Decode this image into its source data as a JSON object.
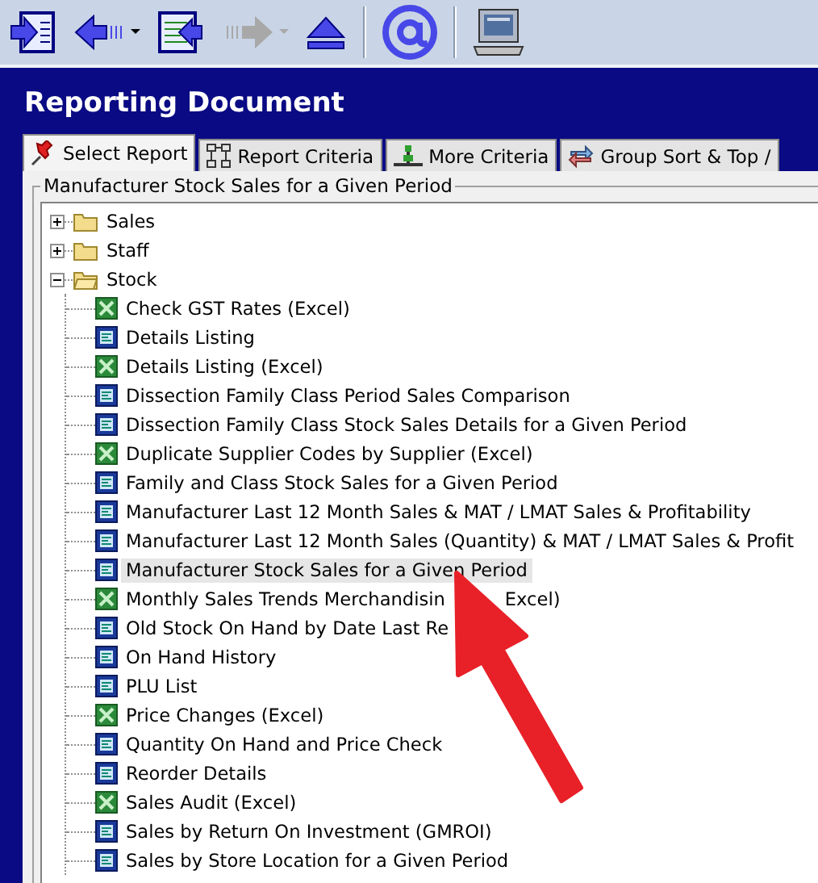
{
  "toolbar": [
    {
      "kind": "panel-in",
      "disabled": false
    },
    {
      "kind": "back",
      "disabled": false,
      "dropdown": true
    },
    {
      "kind": "doc-in",
      "disabled": false
    },
    {
      "kind": "forward",
      "disabled": true,
      "dropdown": true
    },
    {
      "kind": "eject",
      "disabled": false
    },
    {
      "kind": "at",
      "disabled": false
    },
    {
      "kind": "monitor",
      "disabled": false
    }
  ],
  "title": "Reporting Document",
  "tabs": [
    {
      "label": "Select Report",
      "selected": true
    },
    {
      "label": "Report Criteria",
      "selected": false
    },
    {
      "label": "More Criteria",
      "selected": false
    },
    {
      "label": "Group Sort & Top /",
      "selected": false
    }
  ],
  "group_title": "Manufacturer Stock Sales for a Given Period",
  "tree": [
    {
      "label": "Sales",
      "expanded": false
    },
    {
      "label": "Staff",
      "expanded": false
    },
    {
      "label": "Stock",
      "expanded": true,
      "children": [
        {
          "label": "Check GST Rates (Excel)",
          "kind": "excel",
          "selected": false
        },
        {
          "label": "Details Listing",
          "kind": "report",
          "selected": false
        },
        {
          "label": "Details Listing (Excel)",
          "kind": "excel",
          "selected": false
        },
        {
          "label": "Dissection Family Class Period Sales Comparison",
          "kind": "report",
          "selected": false
        },
        {
          "label": "Dissection Family Class Stock Sales Details for a Given Period",
          "kind": "report",
          "selected": false
        },
        {
          "label": "Duplicate Supplier Codes by Supplier (Excel)",
          "kind": "excel",
          "selected": false
        },
        {
          "label": "Family and Class Stock Sales for a Given Period",
          "kind": "report",
          "selected": false
        },
        {
          "label": "Manufacturer Last 12 Month Sales & MAT / LMAT Sales & Profitability",
          "kind": "report",
          "selected": false
        },
        {
          "label": "Manufacturer Last 12 Month Sales (Quantity) & MAT / LMAT Sales & Profit",
          "kind": "report",
          "selected": false
        },
        {
          "label": "Manufacturer Stock Sales for a Given Period",
          "kind": "report",
          "selected": true
        },
        {
          "label": "Monthly Sales Trends Merchandisin",
          "tail": "Excel)",
          "kind": "excel",
          "selected": false
        },
        {
          "label": "Old Stock On Hand by Date Last Re",
          "kind": "report",
          "selected": false
        },
        {
          "label": "On Hand History",
          "kind": "report",
          "selected": false
        },
        {
          "label": "PLU List",
          "kind": "report",
          "selected": false
        },
        {
          "label": "Price Changes (Excel)",
          "kind": "excel",
          "selected": false
        },
        {
          "label": "Quantity On Hand and Price Check",
          "kind": "report",
          "selected": false
        },
        {
          "label": "Reorder Details",
          "kind": "report",
          "selected": false
        },
        {
          "label": "Sales Audit (Excel)",
          "kind": "excel",
          "selected": false
        },
        {
          "label": "Sales by Return On Investment (GMROI)",
          "kind": "report",
          "selected": false
        },
        {
          "label": "Sales by Store Location for a Given Period",
          "kind": "report",
          "selected": false
        }
      ]
    }
  ]
}
